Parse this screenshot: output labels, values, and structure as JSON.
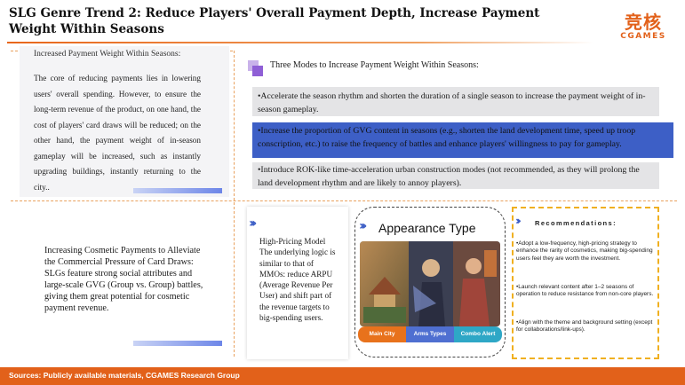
{
  "header": {
    "title": "SLG Genre Trend 2: Reduce Players' Overall Payment Depth, Increase Payment Weight Within Seasons",
    "logo_cn": "竞核",
    "logo_en": "CGAMES"
  },
  "left_top": {
    "heading": "Increased Payment Weight Within Seasons:",
    "body": "The core of reducing payments lies in lowering users' overall spending. However, to ensure the long-term revenue of the product, on one hand, the cost of players' card draws will be reduced; on the other hand, the payment weight of in-season gameplay will be increased, such as instantly upgrading buildings, instantly returning to the city.."
  },
  "modes": {
    "heading": "Three Modes to Increase Payment Weight Within Seasons:",
    "items": [
      "•Accelerate the season rhythm and shorten the duration of a single season to increase the payment weight of in-season gameplay.",
      "•Increase the proportion of GVG content in seasons (e.g., shorten the land development time, speed up troop conscription, etc.) to raise the frequency of battles and enhance players' willingness to pay for gameplay.",
      "•Introduce ROK-like time-acceleration urban construction modes (not recommended, as they will prolong the land development rhythm and are likely to annoy players)."
    ]
  },
  "left_bottom": {
    "text": "Increasing Cosmetic Payments to Alleviate the Commercial Pressure of Card Draws: SLGs feature strong social attributes and large-scale GVG (Group vs. Group) battles, giving them great potential for cosmetic payment revenue."
  },
  "high_pricing": {
    "text": "High-Pricing Model The underlying logic is similar to that of MMOs: reduce ARPU (Average Revenue Per User) and shift part of the revenue targets to big-spending users."
  },
  "appearance": {
    "title": "Appearance Type",
    "tabs": [
      "Main City",
      "Arms Types",
      "Combo Alert"
    ]
  },
  "recommendations": {
    "title": "Recommendations:",
    "items": [
      "•Adopt a low-frequency, high-pricing strategy to enhance the rarity of cosmetics, making big-spending users feel they are worth the investment.",
      "•Launch relevant content after 1–2 seasons of operation to reduce resistance from non-core players.",
      "•Align with the theme and background setting (except for collaborations/link-ups)."
    ]
  },
  "footer": {
    "source": "Sources: Publicly available materials, CGAMES Research Group"
  },
  "colors": {
    "accent_orange": "#e2611a",
    "accent_blue": "#3d5fc6",
    "recommend_border": "#f0b020"
  }
}
